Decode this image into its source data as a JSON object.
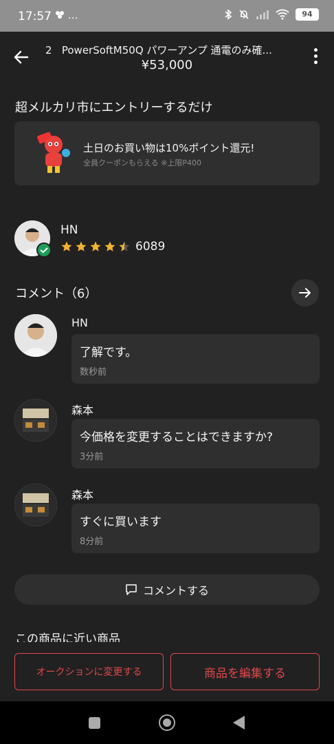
{
  "status_bar": {
    "time": "17:57",
    "extra": "…",
    "battery": "94"
  },
  "header": {
    "index": "2",
    "title": "PowerSoftM50Q パワーアンプ 通電のみ確...",
    "price": "¥53,000"
  },
  "entry": {
    "heading": "超メルカリ市にエントリーするだけ"
  },
  "promo": {
    "main": "土日のお買い物は10%ポイント還元!",
    "sub": "全員クーポンもらえる ※上限P400"
  },
  "seller": {
    "name": "HN",
    "rating": 4.5,
    "rating_count": "6089"
  },
  "comments": {
    "heading": "コメント（6）",
    "items": [
      {
        "name": "HN",
        "text": "了解です。",
        "time": "数秒前"
      },
      {
        "name": "森本",
        "text": "今価格を変更することはできますか?",
        "time": "3分前"
      },
      {
        "name": "森本",
        "text": "すぐに買います",
        "time": "8分前"
      }
    ],
    "button_label": "コメントする"
  },
  "similar_heading": "この商品に近い商品",
  "actions": {
    "auction_label": "オークションに変更する",
    "edit_label": "商品を編集する"
  },
  "colors": {
    "accent": "#e0474c",
    "background": "#212121",
    "card": "#2f2f2f",
    "star": "#f2b233",
    "verified": "#1e9e5a"
  },
  "icons": [
    "back-arrow-icon",
    "more-vert-icon",
    "arrow-right-icon",
    "comment-icon",
    "star-icon",
    "verified-icon",
    "bluetooth-icon",
    "mute-icon",
    "wifi-icon",
    "battery-icon"
  ]
}
